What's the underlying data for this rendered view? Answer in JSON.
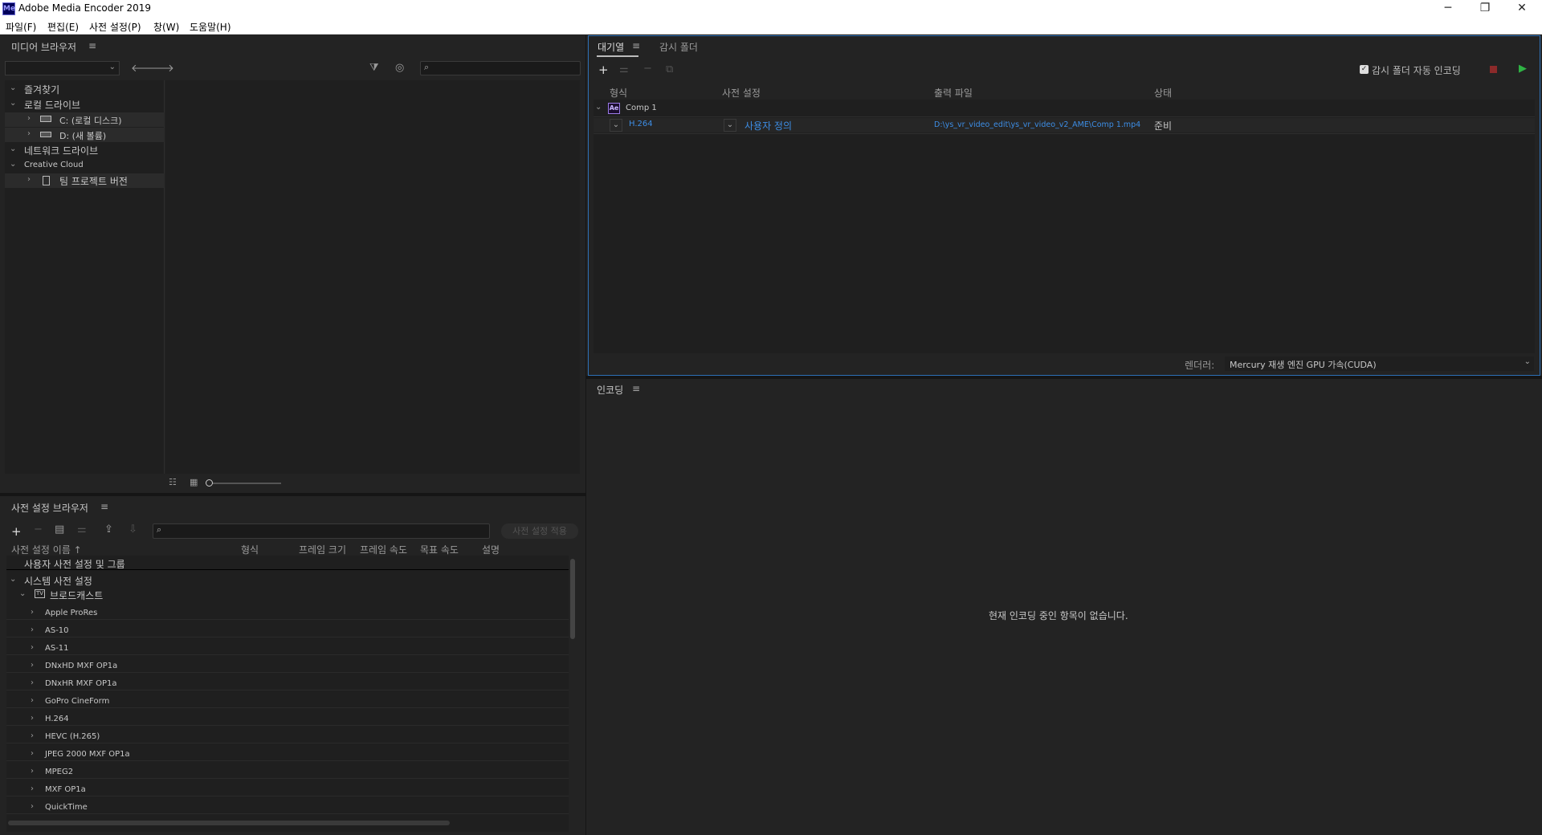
{
  "window": {
    "title": "Adobe Media Encoder 2019",
    "icon_text": "Me"
  },
  "menu": [
    "파일(F)",
    "편집(E)",
    "사전 설정(P)",
    "창(W)",
    "도움말(H)"
  ],
  "media_browser": {
    "title": "미디어 브라우저",
    "tree": {
      "favorites": "즐겨찾기",
      "local_drives": "로컬 드라이브",
      "drive_c": "C: (로컬 디스크)",
      "drive_d": "D: (새 볼륨)",
      "network_drives": "네트워크 드라이브",
      "creative_cloud": "Creative Cloud",
      "team_projects": "팀 프로젝트 버전"
    }
  },
  "preset_browser": {
    "title": "사전 설정 브라우저",
    "apply_button": "사전 설정 적용",
    "columns": [
      "사전 설정 이름 ↑",
      "형식",
      "프레임 크기",
      "프레임 속도",
      "목표 속도",
      "설명"
    ],
    "user_presets": "사용자 사전 설정 및 그룹",
    "system_presets": "시스템 사전 설정",
    "broadcast": "브로드캐스트",
    "items": [
      "Apple ProRes",
      "AS-10",
      "AS-11",
      "DNxHD MXF OP1a",
      "DNxHR MXF OP1a",
      "GoPro CineForm",
      "H.264",
      "HEVC (H.265)",
      "JPEG 2000 MXF OP1a",
      "MPEG2",
      "MXF OP1a",
      "QuickTime"
    ]
  },
  "queue": {
    "tab_queue": "대기열",
    "tab_watch": "감시 폴더",
    "auto_encode_label": "감시 폴더 자동 인코딩",
    "columns": [
      "형식",
      "사전 설정",
      "출력 파일",
      "상태"
    ],
    "comp": {
      "name": "Comp 1",
      "badge": "Ae"
    },
    "job": {
      "format": "H.264",
      "preset": "사용자 정의",
      "output": "D:\\ys_vr_video_edit\\ys_vr_video_v2_AME\\Comp 1.mp4",
      "status": "준비"
    },
    "renderer_label": "렌더러:",
    "renderer_value": "Mercury 재생 엔진 GPU 가속(CUDA)"
  },
  "encoding": {
    "title": "인코딩",
    "empty_message": "현재 인코딩 중인 항목이 없습니다."
  },
  "colors": {
    "accent": "#3d8ee6",
    "focus_border": "#2d6fb5",
    "play": "#2fb344",
    "stop": "#c33a3a"
  }
}
